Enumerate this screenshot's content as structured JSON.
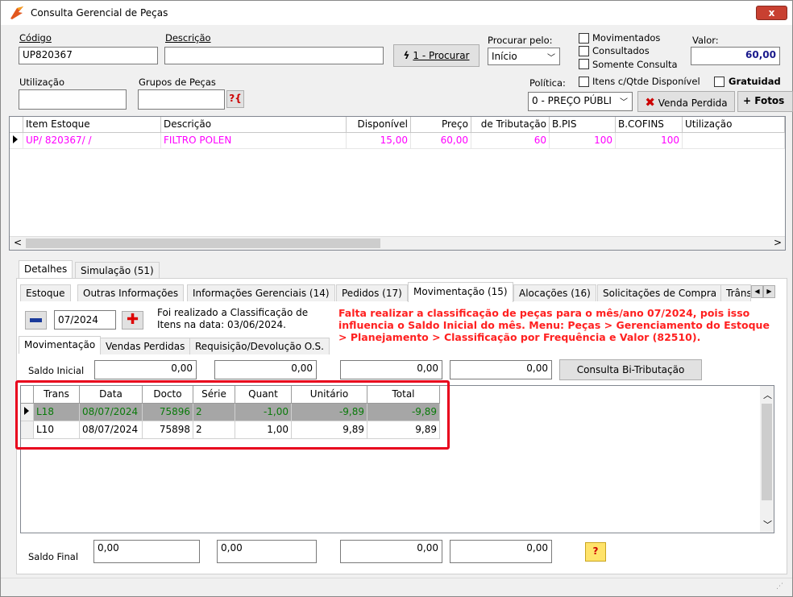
{
  "window": {
    "title": "Consulta Gerencial de Peças",
    "close": "x"
  },
  "form": {
    "codigo_label": "Código",
    "codigo_value": "UP820367",
    "descricao_label": "Descrição",
    "descricao_value": "",
    "procurar_button": "1 - Procurar",
    "procurar_pelo_label": "Procurar pelo:",
    "procurar_pelo_value": "Início",
    "movimentados": "Movimentados",
    "consultados": "Consultados",
    "somente_consulta": "Somente Consulta",
    "valor_label": "Valor:",
    "valor_value": "60,00",
    "utilizacao_label": "Utilização",
    "grupos_label": "Grupos de Peças",
    "grupos_btn": "?{",
    "politica_label": "Política:",
    "politica_value": "0 - PREÇO PÚBLI",
    "itens_qtde": "Itens c/Qtde Disponível",
    "gratuidade": "Gratuidad",
    "venda_perdida": "Venda Perdida",
    "fotos": "+ Fotos"
  },
  "items_grid": {
    "headers": [
      "Item Estoque",
      "Descrição",
      "Disponível",
      "Preço",
      "de Tributação",
      "B.PIS",
      "B.COFINS",
      "Utilização"
    ],
    "row": {
      "item": "UP/  820367/  /",
      "descricao": "FILTRO POLEN",
      "disponivel": "15,00",
      "preco": "60,00",
      "tributacao": "60",
      "bpis": "100",
      "bcofins": "100",
      "utilizacao": ""
    }
  },
  "tabs_top": [
    "Detalhes",
    "Simulação (51)"
  ],
  "tabs_main": [
    "Estoque",
    "Outras Informações",
    "Informações Gerenciais (14)",
    "Pedidos (17)",
    "Movimentação (15)",
    "Alocações (16)",
    "Solicitações de Compra",
    "Trâns"
  ],
  "movimentacao": {
    "period": "07/2024",
    "classif_msg": "Foi realizado a Classificação de Itens na data: 03/06/2024.",
    "warning": "Falta realizar a classificação de peças para o mês/ano 07/2024, pois isso influencia o Saldo Inicial do mês. Menu: Peças > Gerenciamento do Estoque > Planejamento > Classificação por Frequência e Valor (82510).",
    "subtabs": [
      "Movimentação",
      "Vendas Perdidas",
      "Requisição/Devolução O.S."
    ],
    "saldo_inicial_label": "Saldo Inicial",
    "saldo_inicial": [
      "0,00",
      "0,00",
      "0,00",
      "0,00"
    ],
    "bi_tributacao": "Consulta Bi-Tributação",
    "headers": [
      "Trans",
      "Data",
      "Docto",
      "Série",
      "Quant",
      "Unitário",
      "Total"
    ],
    "rows": [
      {
        "trans": "L18",
        "data": "08/07/2024",
        "docto": "75896",
        "serie": "2",
        "quant": "-1,00",
        "unitario": "-9,89",
        "total": "-9,89"
      },
      {
        "trans": "L10",
        "data": "08/07/2024",
        "docto": "75898",
        "serie": "2",
        "quant": "1,00",
        "unitario": "9,89",
        "total": "9,89"
      }
    ],
    "saldo_final_label": "Saldo Final",
    "saldo_final": [
      "0,00",
      "0,00",
      "0,00",
      "0,00"
    ],
    "help_btn": "?"
  },
  "colors": {
    "magenta": "#ff00ff",
    "green": "#008000",
    "red": "#ff2020",
    "highlight": "#e8001c"
  }
}
